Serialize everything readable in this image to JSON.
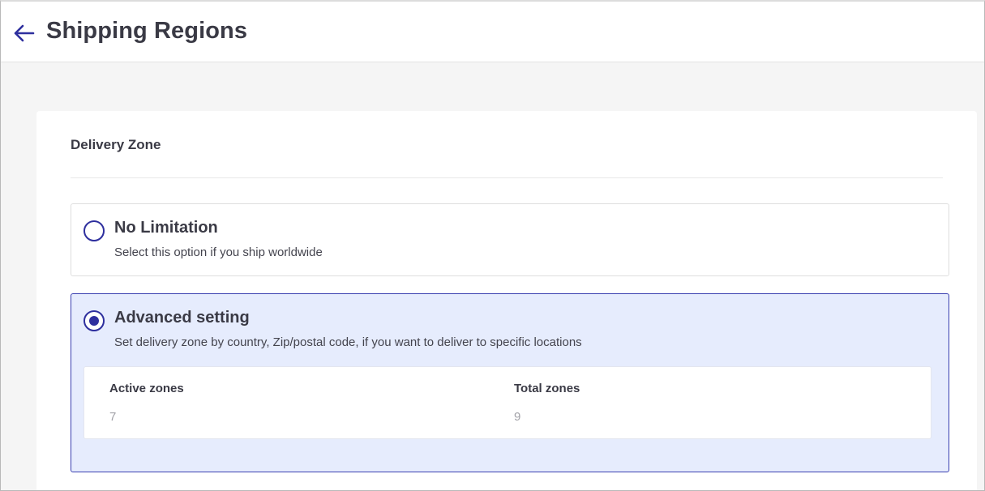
{
  "header": {
    "back_icon": "arrow-left-icon",
    "title": "Shipping Regions"
  },
  "card": {
    "title": "Delivery Zone"
  },
  "options": [
    {
      "label": "No Limitation",
      "description": "Select this option if you ship worldwide",
      "selected": false
    },
    {
      "label": "Advanced setting",
      "description": "Set delivery zone by country, Zip/postal code, if you want to deliver to specific locations",
      "selected": true
    }
  ],
  "zones": {
    "active_label": "Active zones",
    "active_value": "7",
    "total_label": "Total zones",
    "total_value": "9"
  },
  "colors": {
    "accent": "#2e2f9e",
    "selected_bg": "#e6ecfd"
  }
}
